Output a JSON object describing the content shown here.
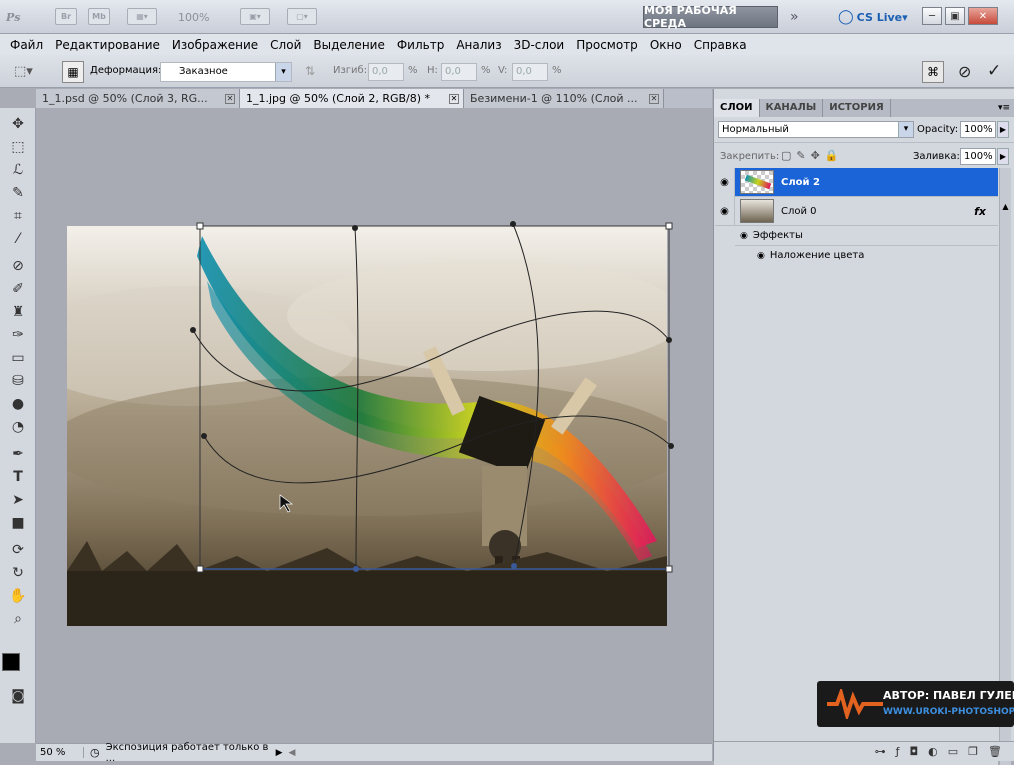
{
  "appbar": {
    "logo": "Ps",
    "br_label": "Br",
    "mb_label": "Mb",
    "zoom": "100%",
    "workspace": "МОЯ РАБОЧАЯ СРЕДА",
    "cslive": "CS Live"
  },
  "menu": [
    "Файл",
    "Редактирование",
    "Изображение",
    "Слой",
    "Выделение",
    "Фильтр",
    "Анализ",
    "3D-слои",
    "Просмотр",
    "Окно",
    "Справка"
  ],
  "options": {
    "warp_label": "Деформация:",
    "warp_value": "Заказное",
    "bend_label": "Изгиб:",
    "bend_value": "0,0",
    "h_label": "H:",
    "h_value": "0,0",
    "v_label": "V:",
    "v_value": "0,0",
    "percent": "%"
  },
  "tabs": [
    {
      "label": "1_1.psd @ 50% (Слой 3, RG..."
    },
    {
      "label": "1_1.jpg @ 50% (Слой 2, RGB/8) *"
    },
    {
      "label": "Безимени-1 @ 110% (Слой ..."
    }
  ],
  "status": {
    "zoom": "50 %",
    "message": "Экспозиция работает только в ..."
  },
  "panel": {
    "tabs": [
      "СЛОИ",
      "КАНАЛЫ",
      "ИСТОРИЯ"
    ],
    "blend_mode": "Нормальный",
    "opacity_label": "Opacity:",
    "opacity_value": "100%",
    "lock_label": "Закрепить:",
    "fill_label": "Заливка:",
    "fill_value": "100%",
    "layers": [
      {
        "name": "Слой 2"
      },
      {
        "name": "Слой 0",
        "fx": "fx"
      }
    ],
    "effects_label": "Эффекты",
    "effect_item": "Наложение цвета"
  },
  "watermark": {
    "author": "АВТОР: ПАВЕЛ ГУЛЕВИЧ",
    "site": "WWW.UROKI-PHOTOSHOP.COM"
  },
  "colors": {
    "selection": "#1b64d8",
    "accent_blue": "#1a5fb4"
  }
}
